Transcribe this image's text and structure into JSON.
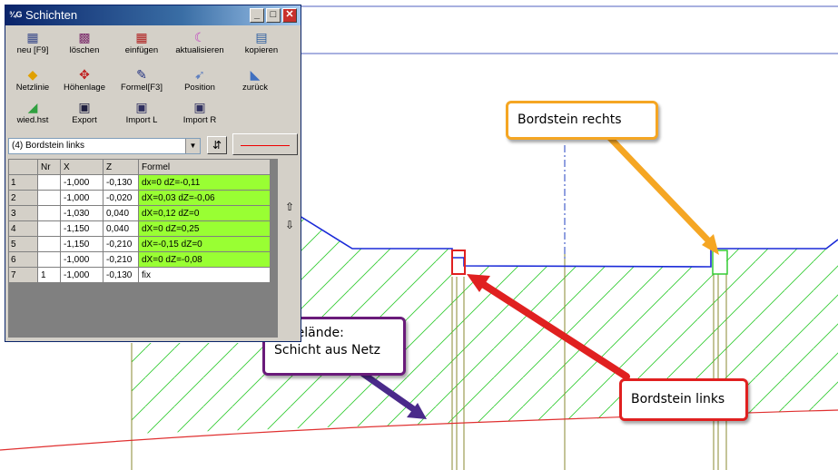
{
  "window": {
    "icon_text": "¾G",
    "title": "Schichten",
    "minimize": "_",
    "maximize": "□",
    "close": "✕"
  },
  "toolbar": {
    "row1": [
      {
        "label": "neu [F9]",
        "icon": "grid-add-icon",
        "glyph": "▦",
        "color": "#3a4a8a"
      },
      {
        "label": "löschen",
        "icon": "grid-delete-icon",
        "glyph": "▩",
        "color": "#7a2a6a"
      },
      {
        "label": "einfügen",
        "icon": "grid-insert-icon",
        "glyph": "▦",
        "color": "#b02020"
      },
      {
        "label": "aktualisieren",
        "icon": "refresh-curve-icon",
        "glyph": "☾",
        "color": "#c040c0"
      },
      {
        "label": "kopieren",
        "icon": "copy-grid-icon",
        "glyph": "▤",
        "color": "#3060a0"
      }
    ],
    "row2": [
      {
        "label": "Netzlinie",
        "icon": "netline-icon",
        "glyph": "◆",
        "color": "#e0a000"
      },
      {
        "label": "Höhenlage",
        "icon": "height-arrows-icon",
        "glyph": "✥",
        "color": "#c02020"
      },
      {
        "label": "Formel[F3]",
        "icon": "formula-pen-icon",
        "glyph": "✎",
        "color": "#203080"
      },
      {
        "label": "Position",
        "icon": "position-cursor-icon",
        "glyph": "➹",
        "color": "#6080c0"
      },
      {
        "label": "zurück",
        "icon": "back-arrow-icon",
        "glyph": "◣",
        "color": "#4070c0"
      }
    ],
    "row3": [
      {
        "label": "wied.hst",
        "icon": "restore-icon",
        "glyph": "◢",
        "color": "#30a040"
      },
      {
        "label": "Export",
        "icon": "export-disk-icon",
        "glyph": "▣",
        "color": "#202040"
      },
      {
        "label": "Import L",
        "icon": "import-left-disk-icon",
        "glyph": "▣",
        "color": "#303060"
      },
      {
        "label": "Import R",
        "icon": "import-right-disk-icon",
        "glyph": "▣",
        "color": "#303060"
      }
    ]
  },
  "layer_select": {
    "value": "(4) Bordstein links",
    "arrow": "▼"
  },
  "pick_button_glyph": "⇵",
  "table": {
    "headers": [
      "",
      "Nr",
      "X",
      "Z",
      "Formel"
    ],
    "rows": [
      {
        "n": "1",
        "nr": "",
        "x": "-1,000",
        "z": "-0,130",
        "formel": "dx=0 dZ=-0,11",
        "green": true
      },
      {
        "n": "2",
        "nr": "",
        "x": "-1,000",
        "z": "-0,020",
        "formel": "dX=0,03 dZ=-0,06",
        "green": true
      },
      {
        "n": "3",
        "nr": "",
        "x": "-1,030",
        "z": "0,040",
        "formel": "dX=0,12 dZ=0",
        "green": true
      },
      {
        "n": "4",
        "nr": "",
        "x": "-1,150",
        "z": "0,040",
        "formel": "dX=0 dZ=0,25",
        "green": true
      },
      {
        "n": "5",
        "nr": "",
        "x": "-1,150",
        "z": "-0,210",
        "formel": "dX=-0,15 dZ=0",
        "green": true
      },
      {
        "n": "6",
        "nr": "",
        "x": "-1,000",
        "z": "-0,210",
        "formel": "dX=0 dZ=-0,08",
        "green": true
      },
      {
        "n": "7",
        "nr": "1",
        "x": "-1,000",
        "z": "-0,130",
        "formel": "fix",
        "green": false
      }
    ],
    "up_glyph": "⇧",
    "down_glyph": "⇩"
  },
  "callouts": {
    "bordstein_rechts": {
      "text": "Bordstein rechts",
      "color": "#f5a623"
    },
    "urgelaende": {
      "line1": "Urgelände:",
      "line2": "Schicht aus Netz",
      "color": "#6a1b7a"
    },
    "bordstein_links": {
      "text": "Bordstein links",
      "color": "#e02020"
    }
  },
  "colors": {
    "hatch": "#33cc33",
    "terrain_line": "#e03030",
    "surface_line": "#1a2ad8",
    "vertical_lines": "#8a8a30",
    "axis": "#2040c0"
  }
}
